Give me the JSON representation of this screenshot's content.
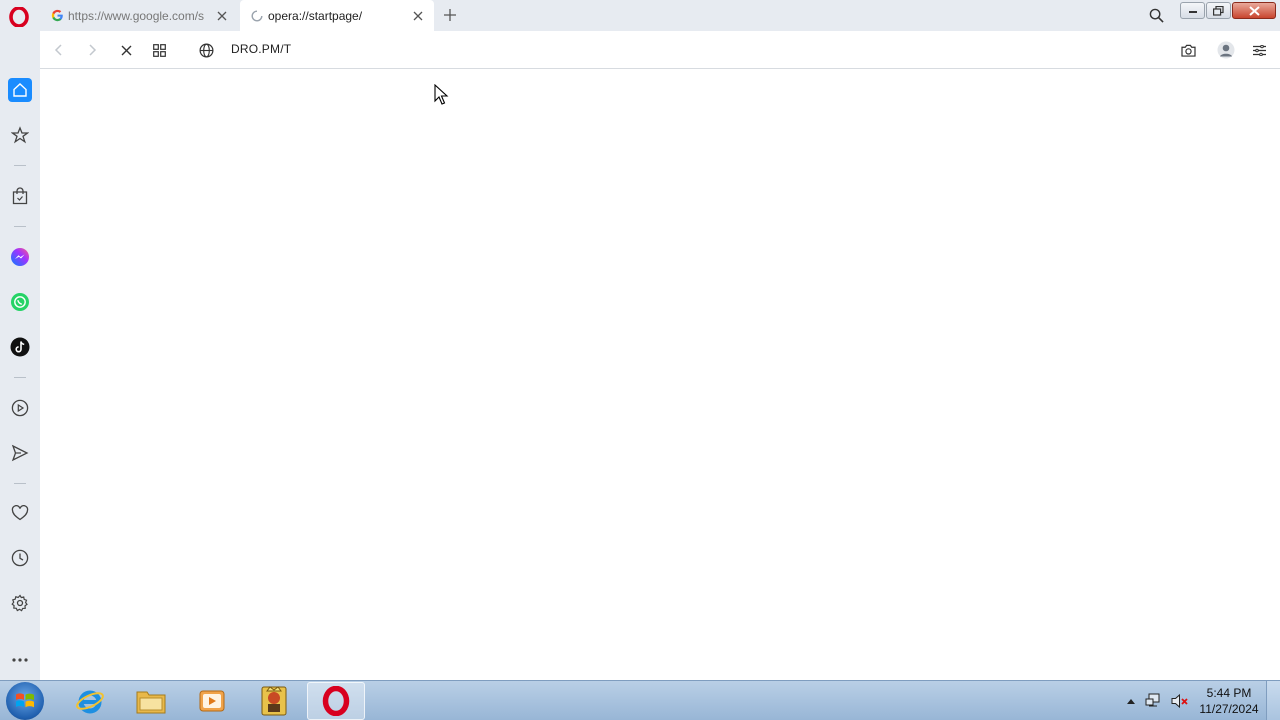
{
  "browser": {
    "tabs": [
      {
        "title": "https://www.google.com/s",
        "state": "inactive",
        "favicon": "google-g-icon"
      },
      {
        "title": "opera://startpage/",
        "state": "active-loading",
        "favicon": "loading-spinner-icon"
      }
    ],
    "address_bar": {
      "url": "DRO.PM/T"
    }
  },
  "sidebar": {
    "items": [
      "home-icon",
      "speed-dial-star-icon",
      "shopping-bag-icon",
      "messenger-icon",
      "whatsapp-icon",
      "tiktok-icon",
      "player-icon",
      "send-icon",
      "heart-icon",
      "history-clock-icon",
      "settings-gear-icon",
      "more-dots-icon"
    ]
  },
  "taskbar": {
    "apps": [
      "internet-explorer-icon",
      "file-explorer-icon",
      "media-player-icon",
      "game-app-icon",
      "opera-icon"
    ],
    "clock": {
      "time": "5:44 PM",
      "date": "11/27/2024"
    }
  },
  "colors": {
    "accent": "#1a8cff",
    "opera_red": "#d8001f",
    "chrome": "#e7ebf1"
  }
}
